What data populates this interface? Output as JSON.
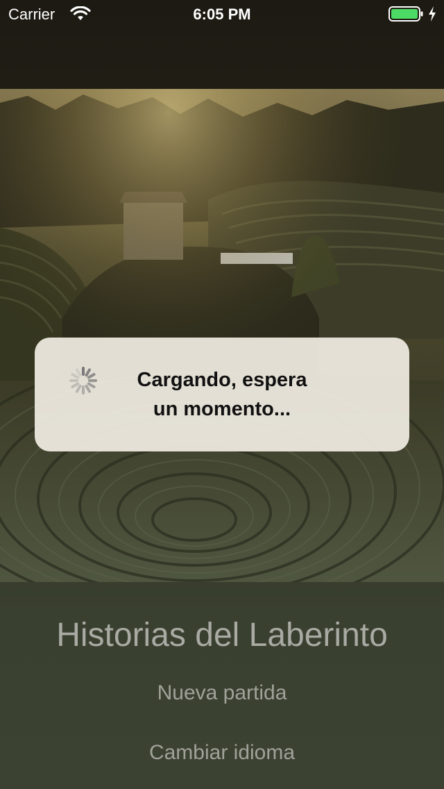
{
  "status_bar": {
    "carrier": "Carrier",
    "time": "6:05 PM",
    "battery_color": "#4cd964"
  },
  "hero": {
    "image": "terraced-tea-field-landscape"
  },
  "loading": {
    "line1": "Cargando, espera",
    "line2": "un momento..."
  },
  "menu": {
    "title": "Historias del Laberinto",
    "new_game": "Nueva partida",
    "change_language": "Cambiar idioma"
  }
}
